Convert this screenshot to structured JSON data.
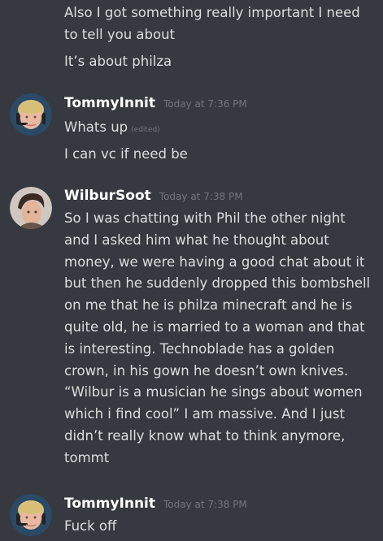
{
  "messages_top": {
    "line1": "Also I got something really important I need",
    "line2": "to tell you about",
    "line3": "It’s about philza"
  },
  "groups": [
    {
      "username": "TommyInnit",
      "timestamp": "Today at 7:36 PM",
      "lines": [
        "Whats up",
        "I can vc if need be"
      ],
      "edited_label": "(edited)"
    },
    {
      "username": "WilburSoot",
      "timestamp": "Today at 7:38 PM",
      "text": "So I was chatting with Phil the other night\nand I asked him what he thought about\nmoney, we were having a good chat about it\nbut then he suddenly dropped this bombshell\non me that he is philza minecraft and he is\nquite old, he is married to a woman and that\nis interesting. Technoblade has a golden\ncrown, in his gown he doesn’t own knives.\n“Wilbur is a musician he sings about women\nwhich i find cool” I am massive. And I just\ndidn’t really know what to think anymore,\ntommt"
    },
    {
      "username": "TommyInnit",
      "timestamp": "Today at 7:38 PM",
      "lines": [
        "Fuck off"
      ]
    }
  ],
  "colors": {
    "background": "#36393f",
    "text": "#dcddde",
    "username": "#ffffff",
    "timestamp": "#72767d"
  }
}
